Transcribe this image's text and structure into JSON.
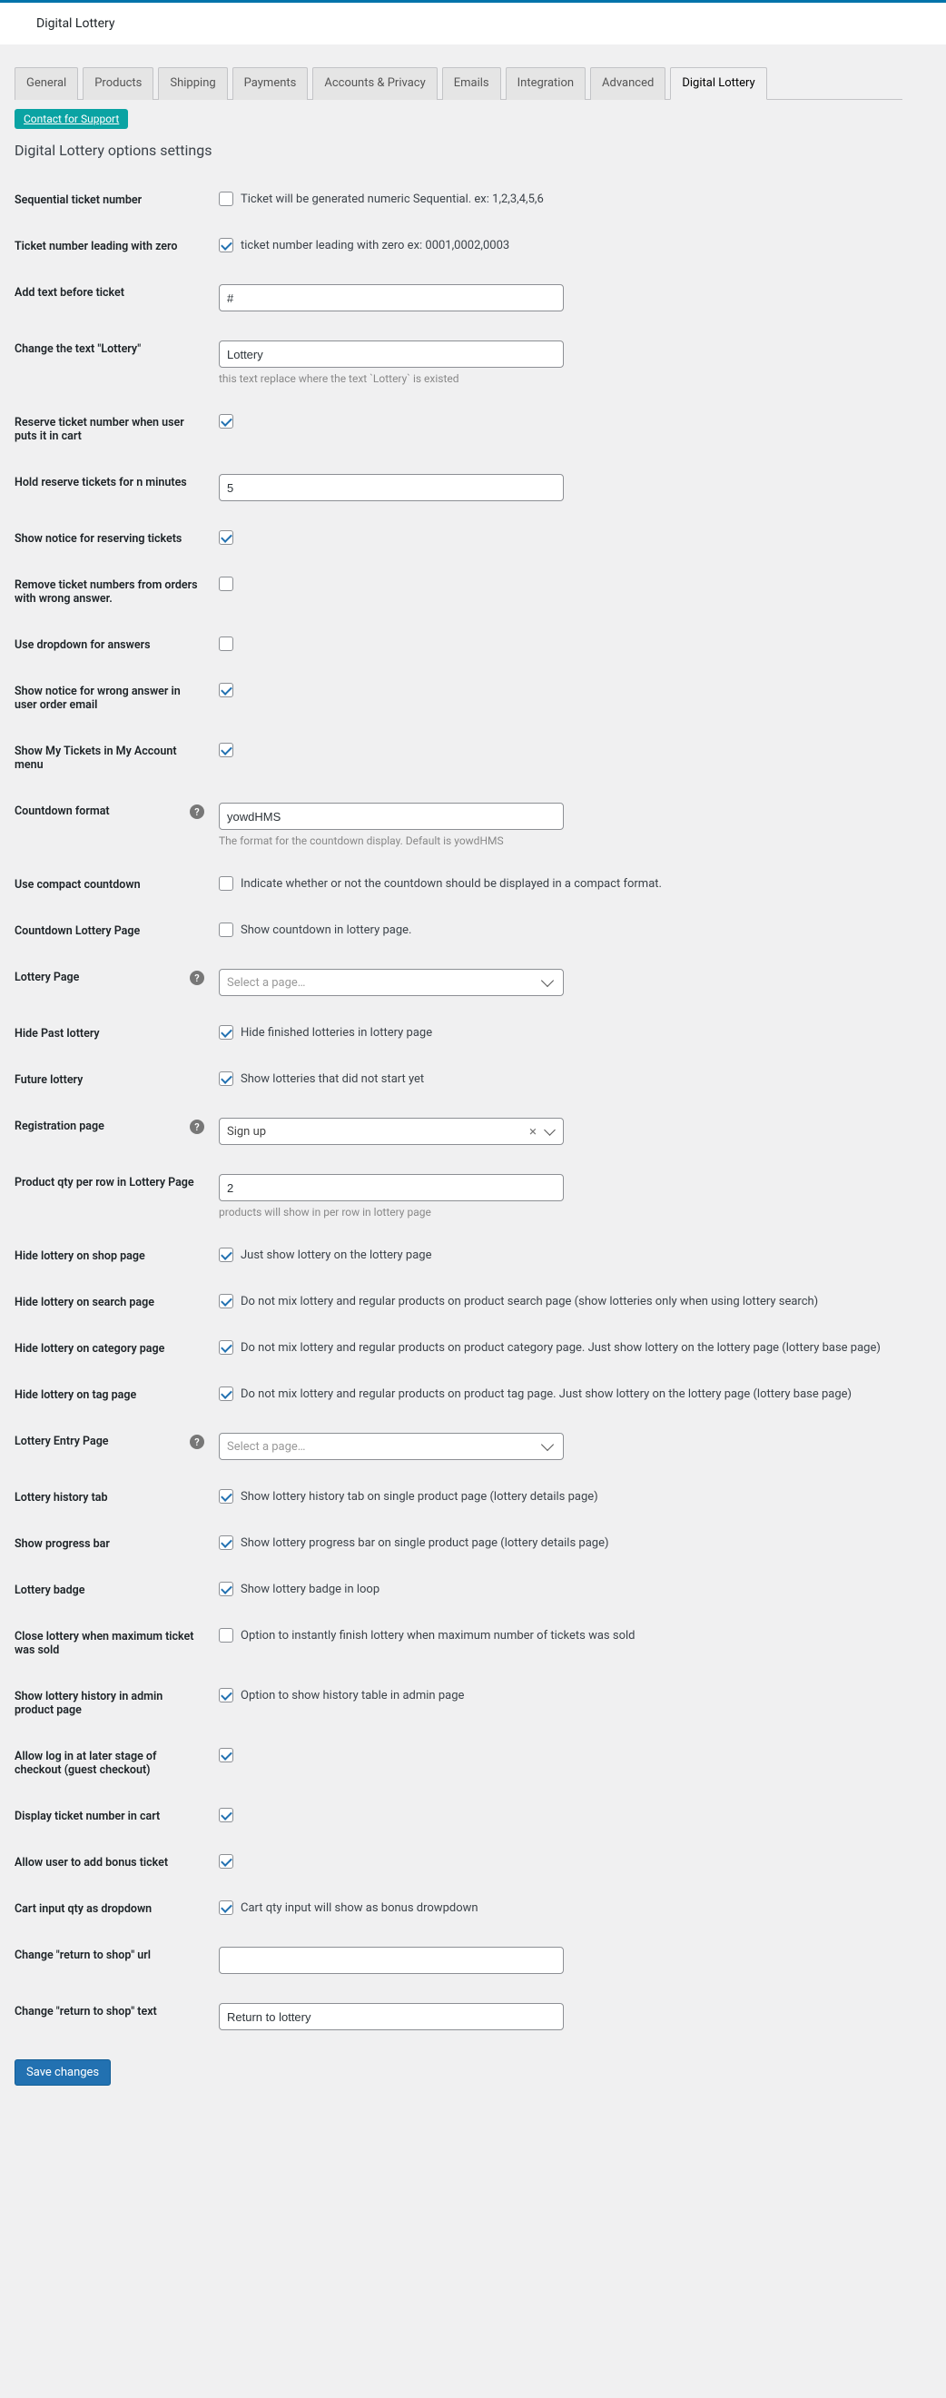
{
  "header": {
    "title": "Digital Lottery"
  },
  "tabs": {
    "items": [
      "General",
      "Products",
      "Shipping",
      "Payments",
      "Accounts & Privacy",
      "Emails",
      "Integration",
      "Advanced",
      "Digital Lottery"
    ],
    "activeIndex": 8
  },
  "support": {
    "label": "Contact for Support"
  },
  "section": {
    "title": "Digital Lottery options settings"
  },
  "rows": {
    "seq_ticket": {
      "label": "Sequential ticket number",
      "checked": false,
      "text": "Ticket will be generated numeric Sequential. ex: 1,2,3,4,5,6"
    },
    "leading_zero": {
      "label": "Ticket number leading with zero",
      "checked": true,
      "text": "ticket number leading with zero ex: 0001,0002,0003"
    },
    "before_text": {
      "label": "Add text before ticket",
      "value": "#"
    },
    "change_lottery": {
      "label": "Change the text \"Lottery\"",
      "value": "Lottery",
      "desc": "this text replace where the text `Lottery` is existed"
    },
    "reserve_cart": {
      "label": "Reserve ticket number when user puts it in cart",
      "checked": true
    },
    "hold_minutes": {
      "label": "Hold reserve tickets for n minutes",
      "value": "5"
    },
    "notice_reserve": {
      "label": "Show notice for reserving tickets",
      "checked": true
    },
    "remove_wrong": {
      "label": "Remove ticket numbers from orders with wrong answer.",
      "checked": false
    },
    "dropdown_ans": {
      "label": "Use dropdown for answers",
      "checked": false
    },
    "notice_wrong": {
      "label": "Show notice for wrong answer in user order email",
      "checked": true
    },
    "my_tickets": {
      "label": "Show My Tickets in My Account menu",
      "checked": true
    },
    "countdown_fmt": {
      "label": "Countdown format",
      "value": "yowdHMS",
      "desc": "The format for the countdown display. Default is yowdHMS",
      "help": true
    },
    "compact_cd": {
      "label": "Use compact countdown",
      "checked": false,
      "text": "Indicate whether or not the countdown should be displayed in a compact format."
    },
    "cd_lottery_page": {
      "label": "Countdown Lottery Page",
      "checked": false,
      "text": "Show countdown in lottery page."
    },
    "lottery_page": {
      "label": "Lottery Page",
      "placeholder": "Select a page…",
      "help": true
    },
    "hide_past": {
      "label": "Hide Past lottery",
      "checked": true,
      "text": "Hide finished lotteries in lottery page"
    },
    "future_lottery": {
      "label": "Future lottery",
      "checked": true,
      "text": "Show lotteries that did not start yet"
    },
    "reg_page": {
      "label": "Registration page",
      "value": "Sign up",
      "help": true
    },
    "qty_per_row": {
      "label": "Product qty per row in Lottery Page",
      "value": "2",
      "desc": "products will show in per row in lottery page"
    },
    "hide_shop": {
      "label": "Hide lottery on shop page",
      "checked": true,
      "text": "Just show lottery on the lottery page"
    },
    "hide_search": {
      "label": "Hide lottery on search page",
      "checked": true,
      "text": "Do not mix lottery and regular products on product search page (show lotteries only when using lottery search)"
    },
    "hide_category": {
      "label": "Hide lottery on category page",
      "checked": true,
      "text": "Do not mix lottery and regular products on product category page. Just show lottery on the lottery page (lottery base page)"
    },
    "hide_tag": {
      "label": "Hide lottery on tag page",
      "checked": true,
      "text": "Do not mix lottery and regular products on product tag page. Just show lottery on the lottery page (lottery base page)"
    },
    "entry_page": {
      "label": "Lottery Entry Page",
      "placeholder": "Select a page…",
      "help": true
    },
    "history_tab": {
      "label": "Lottery history tab",
      "checked": true,
      "text": "Show lottery history tab on single product page (lottery details page)"
    },
    "progress_bar": {
      "label": "Show progress bar",
      "checked": true,
      "text": "Show lottery progress bar on single product page (lottery details page)"
    },
    "badge": {
      "label": "Lottery badge",
      "checked": true,
      "text": "Show lottery badge in loop"
    },
    "close_max": {
      "label": "Close lottery when maximum ticket was sold",
      "checked": false,
      "text": "Option to instantly finish lottery when maximum number of tickets was sold"
    },
    "history_admin": {
      "label": "Show lottery history in admin product page",
      "checked": true,
      "text": "Option to show history table in admin page"
    },
    "allow_login": {
      "label": "Allow log in at later stage of checkout (guest checkout)",
      "checked": true
    },
    "display_cart": {
      "label": "Display ticket number in cart",
      "checked": true
    },
    "allow_bonus": {
      "label": "Allow user to add bonus ticket",
      "checked": true
    },
    "cart_qty_dd": {
      "label": "Cart input qty as dropdown",
      "checked": true,
      "text": "Cart qty input will show as bonus drowpdown"
    },
    "return_url": {
      "label": "Change \"return to shop\" url",
      "value": ""
    },
    "return_text": {
      "label": "Change \"return to shop\" text",
      "value": "Return to lottery"
    }
  },
  "save": {
    "label": "Save changes"
  }
}
